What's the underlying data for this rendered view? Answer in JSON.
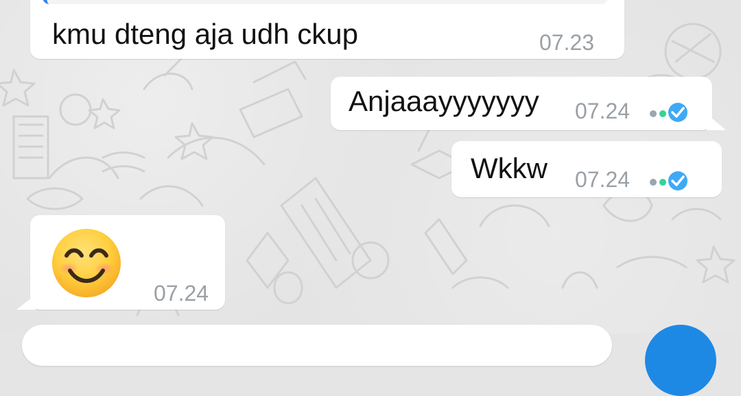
{
  "messages": [
    {
      "id": "m1",
      "direction": "incoming",
      "text": "kmu dteng aja udh ckup",
      "time": "07.23"
    },
    {
      "id": "m2",
      "direction": "outgoing",
      "text": "Anjaaayyyyyyy",
      "time": "07.24",
      "status": "read"
    },
    {
      "id": "m3",
      "direction": "outgoing",
      "text": "Wkkw",
      "time": "07.24",
      "status": "read"
    },
    {
      "id": "m4",
      "direction": "incoming",
      "emoji": "smiling-face-with-smiling-eyes",
      "time": "07.24"
    }
  ],
  "colors": {
    "bubble": "#ffffff",
    "timestamp": "#9aa0a6",
    "read_tick": "#3fa9f5",
    "accent": "#1e88e5",
    "reply_accent": "#2f80ed"
  },
  "icons": {
    "read_status": "double-check-icon",
    "send": "send-button-icon"
  }
}
